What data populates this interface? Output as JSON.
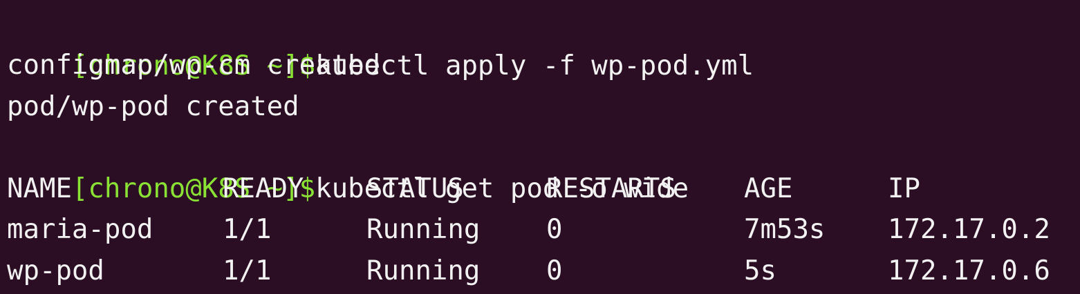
{
  "colors": {
    "background": "#2b0e24",
    "text": "#f2f2f2",
    "prompt": "#8ae234"
  },
  "lines": [
    {
      "prompt": "[chrono@K8S ~]$",
      "command": "kubectl apply -f wp-pod.yml"
    },
    {
      "output": "configmap/wp-cm created"
    },
    {
      "output": "pod/wp-pod created"
    },
    {
      "prompt": "[chrono@K8S ~]$",
      "command": "kubectl get pod -o wide"
    }
  ],
  "table": {
    "headers": [
      "NAME",
      "READY",
      "STATUS",
      "RESTARTS",
      "AGE",
      "IP"
    ],
    "rows": [
      [
        "maria-pod",
        "1/1",
        "Running",
        "0",
        "7m53s",
        "172.17.0.2"
      ],
      [
        "wp-pod",
        "1/1",
        "Running",
        "0",
        "5s",
        "172.17.0.6"
      ]
    ]
  }
}
